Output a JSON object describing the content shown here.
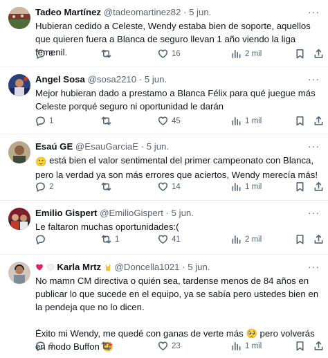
{
  "tweets": [
    {
      "name": "Tadeo Martínez",
      "handle": "@tadeomartinez82",
      "time": "5 jun.",
      "lines": [
        "Hubieran cedido a Celeste, Wendy estaba bien de soporte, aquellos que quieren fuera a Blanca de seguro llevan 1 año viendo la liga femenil."
      ],
      "replies": "9",
      "retweets": "",
      "likes": "16",
      "views": "2 mil",
      "avatar": "avatar-stadium"
    },
    {
      "name": "Angel Sosa",
      "handle": "@sosa2210",
      "time": "5 jun.",
      "lines": [
        "Mejor hubieran dado a prestamo a Blanca Félix para qué juegue más Celeste porqué seguro ni oportunidad le darán"
      ],
      "replies": "1",
      "retweets": "",
      "likes": "45",
      "views": "1 mil",
      "avatar": "avatar-player"
    },
    {
      "name": "Esaú GE",
      "handle": "@EsauGarciaE",
      "time": "5 jun.",
      "lines": [
        "está bien el valor sentimental del primer campeonato con Blanca, pero la verdad ya son más errores que aciertos, Wendy merecía más!"
      ],
      "replies": "2",
      "retweets": "",
      "likes": "14",
      "views": "1 mil",
      "avatar": "avatar-person"
    },
    {
      "name": "Emilio Gispert",
      "handle": "@EmilioGispert",
      "time": "5 jun.",
      "lines": [
        "Le faltaron muchas oportunidades:("
      ],
      "replies": "",
      "retweets": "1",
      "likes": "41",
      "views": "2 mil",
      "avatar": "avatar-fans"
    },
    {
      "name": "Karla Mrtz",
      "handle": "@Doncella1021",
      "time": "5 jun.",
      "lines": [
        "No mamn CM directiva o quién sea, tardense menos de 84 años en publicar lo que sucede en el equipo, ya se sabía pero ustedes bien en la pendeja que no lo dicen.",
        "Éxito mi Wendy, me quedé con ganas de verte más 🥺 pero volverás en modo Buffon 🤩"
      ],
      "replies": "9",
      "retweets": "",
      "likes": "23",
      "views": "1 mil",
      "avatar": "avatar-girl"
    }
  ],
  "ui": {
    "more_glyph": "···",
    "separator": "·",
    "emoji_pleading": "🙂"
  },
  "colors": {
    "text": "#0f1419",
    "secondary": "#536471",
    "border": "#eff3f4"
  }
}
